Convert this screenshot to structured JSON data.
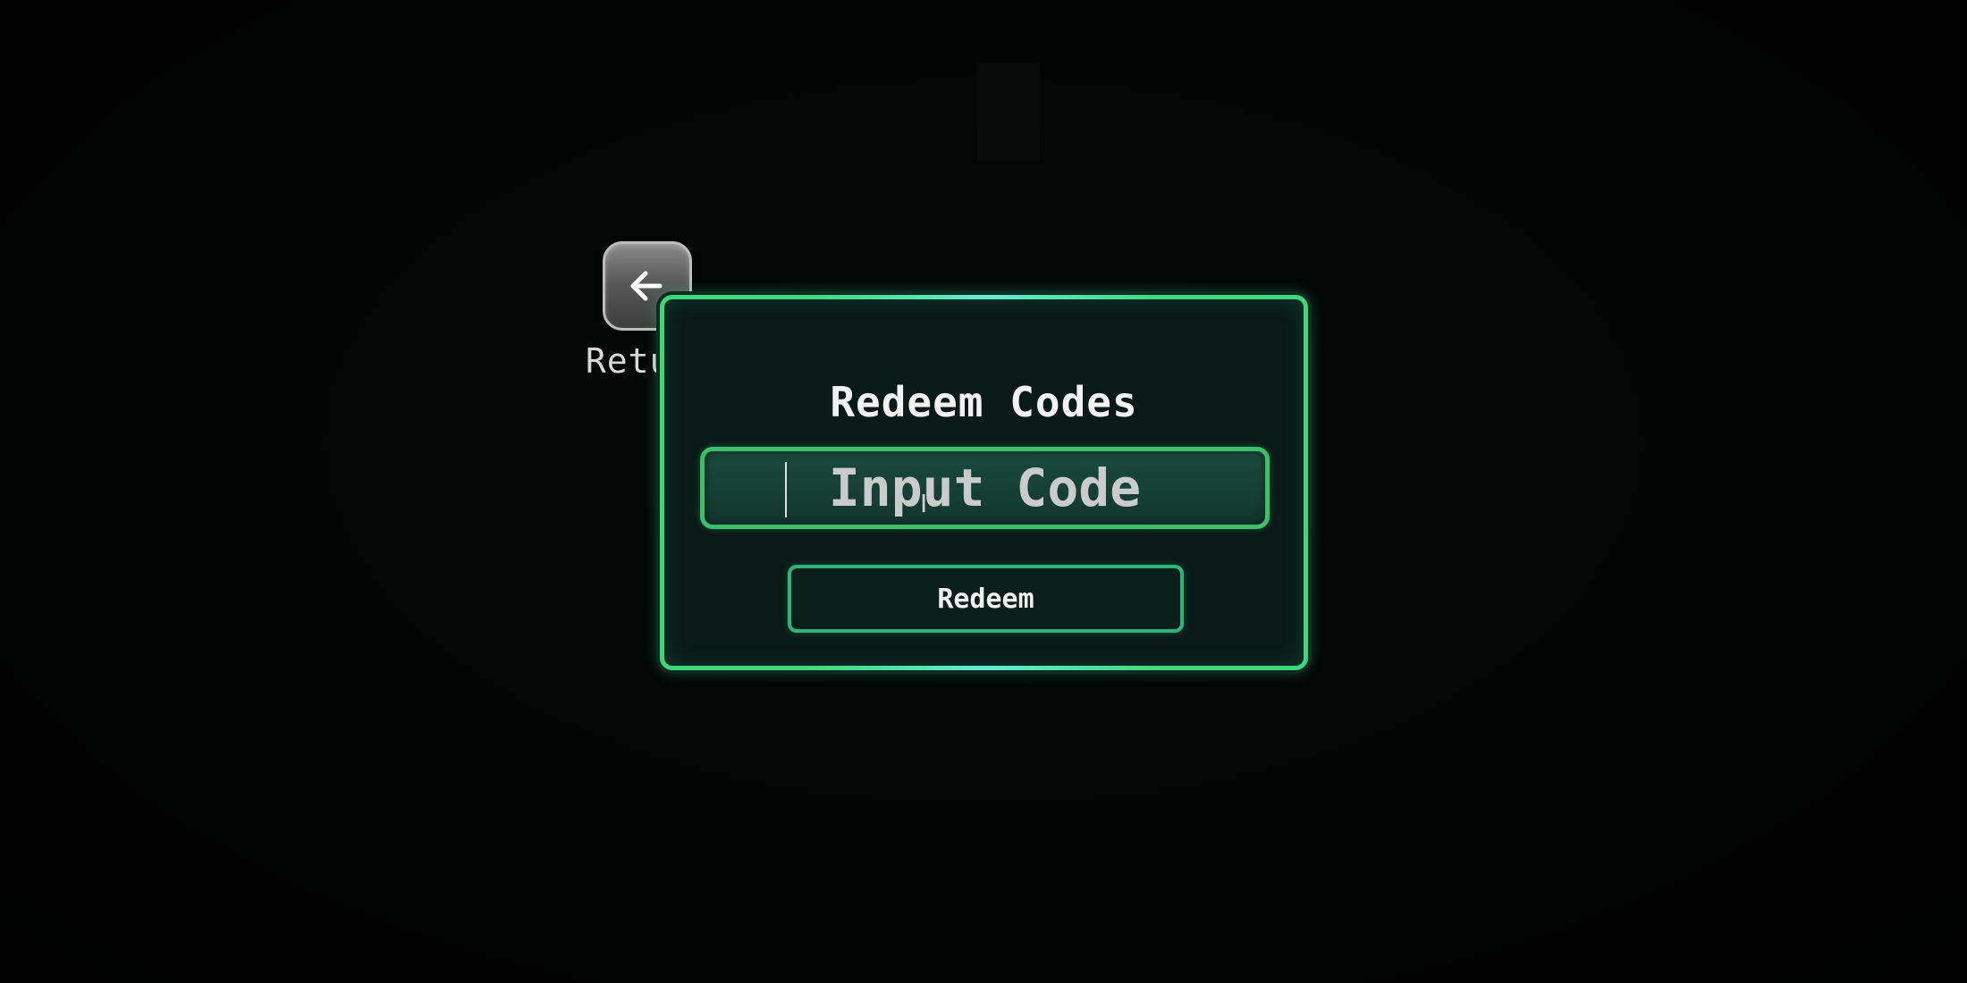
{
  "return_button": {
    "label": "Return",
    "icon": "arrow-left-icon"
  },
  "redeem_panel": {
    "title": "Redeem Codes",
    "code_input": {
      "value": "",
      "placeholder": "Input Code"
    },
    "redeem_button_label": "Redeem"
  },
  "colors": {
    "panel_border": "#3fd778",
    "panel_bg": "#0a1a17",
    "input_bg": "#163f33",
    "button_border": "#2fb37a",
    "background": "#020303"
  }
}
